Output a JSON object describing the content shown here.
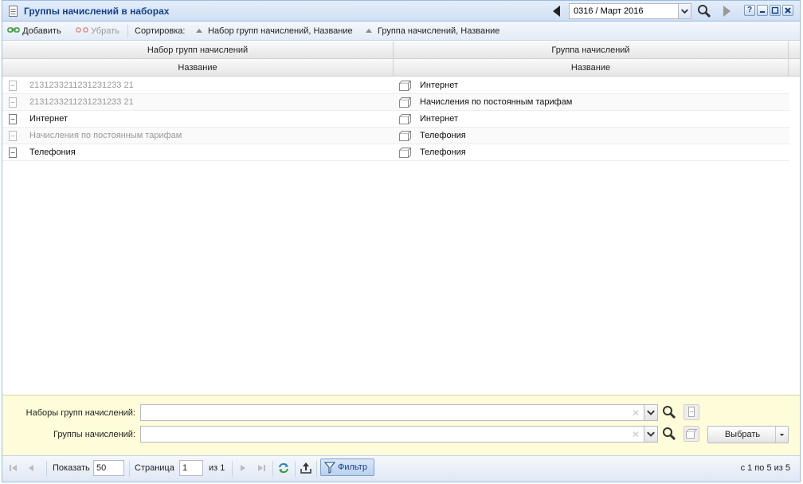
{
  "window": {
    "title": "Группы начислений в наборах",
    "period": "0316 / Март 2016",
    "help_label": "?"
  },
  "toolbar": {
    "add_label": "Добавить",
    "remove_label": "Убрать",
    "sort_label": "Сортировка:",
    "sort1_label": "Набор групп начислений, Название",
    "sort2_label": "Группа начислений, Название"
  },
  "grid": {
    "group_headers": [
      "Набор групп начислений",
      "Группа начислений"
    ],
    "col_headers": [
      "Название",
      "Название"
    ],
    "rows": [
      {
        "set": "2131233211231231233 21",
        "group": "Интернет",
        "set_disabled": true
      },
      {
        "set": "2131233211231231233 21",
        "group": "Начисления по постоянным тарифам",
        "set_disabled": true
      },
      {
        "set": "Интернет",
        "group": "Интернет",
        "set_disabled": false
      },
      {
        "set": "Начисления по постоянным тарифам",
        "group": "Телефония",
        "set_disabled": true
      },
      {
        "set": "Телефония",
        "group": "Телефония",
        "set_disabled": false
      }
    ]
  },
  "filter": {
    "sets_label": "Наборы групп начислений:",
    "groups_label": "Группы начислений:",
    "sets_value": "",
    "groups_value": "",
    "clear_glyph": "✕",
    "select_label": "Выбрать"
  },
  "pager": {
    "show_label": "Показать",
    "page_size": "50",
    "page_label": "Страница",
    "page": "1",
    "of_label": "из 1",
    "filter_label": "Фильтр",
    "summary": "с 1 по 5 из 5"
  }
}
